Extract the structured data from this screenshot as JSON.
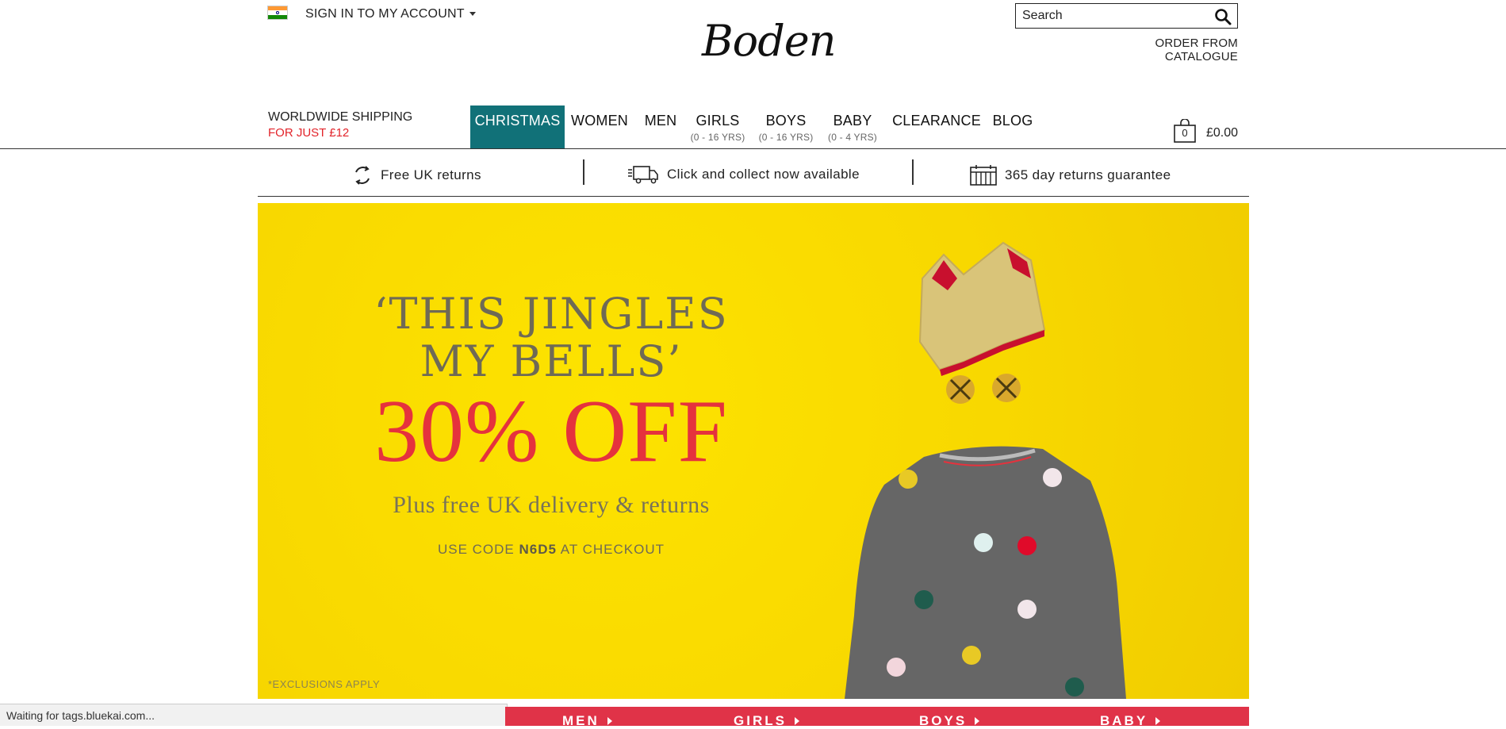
{
  "header": {
    "sign_in_label": "SIGN IN TO MY ACCOUNT",
    "logo_text": "Boden",
    "search": {
      "placeholder": "Search"
    },
    "order_catalogue": "ORDER FROM CATALOGUE",
    "flag_icon": "india-flag-icon"
  },
  "shipping": {
    "line1": "WORLDWIDE SHIPPING",
    "line2": "FOR JUST £12",
    "accent": "#e2232a"
  },
  "nav": {
    "active_color": "#117178",
    "items": [
      {
        "label": "CHRISTMAS",
        "sub": ""
      },
      {
        "label": "WOMEN",
        "sub": ""
      },
      {
        "label": "MEN",
        "sub": ""
      },
      {
        "label": "GIRLS",
        "sub": "(0 - 16 YRS)"
      },
      {
        "label": "BOYS",
        "sub": "(0 - 16 YRS)"
      },
      {
        "label": "BABY",
        "sub": "(0 - 4 YRS)"
      },
      {
        "label": "CLEARANCE",
        "sub": ""
      },
      {
        "label": "BLOG",
        "sub": ""
      }
    ]
  },
  "basket": {
    "count": "0",
    "total": "£0.00"
  },
  "usps": [
    {
      "icon": "returns-arrows-icon",
      "text": "Free UK returns"
    },
    {
      "icon": "delivery-van-icon",
      "text": "Click and collect now available"
    },
    {
      "icon": "calendar-icon",
      "text": "365 day returns guarantee"
    }
  ],
  "hero": {
    "line1": "‘THIS JINGLES",
    "line2": "MY BELLS’",
    "offer": "30% OFF",
    "sub": "Plus free UK delivery & returns",
    "code_prefix": "USE CODE",
    "code": "N6D5",
    "code_suffix": "AT CHECKOUT",
    "exclusions": "*EXCLUSIONS APPLY",
    "bg_color": "#f8d800",
    "offer_color": "#e5323d"
  },
  "status_bar": "Waiting for tags.bluekai.com...",
  "category_strip": {
    "color": "#e03348",
    "items": [
      "MEN",
      "GIRLS",
      "BOYS",
      "BABY"
    ]
  }
}
